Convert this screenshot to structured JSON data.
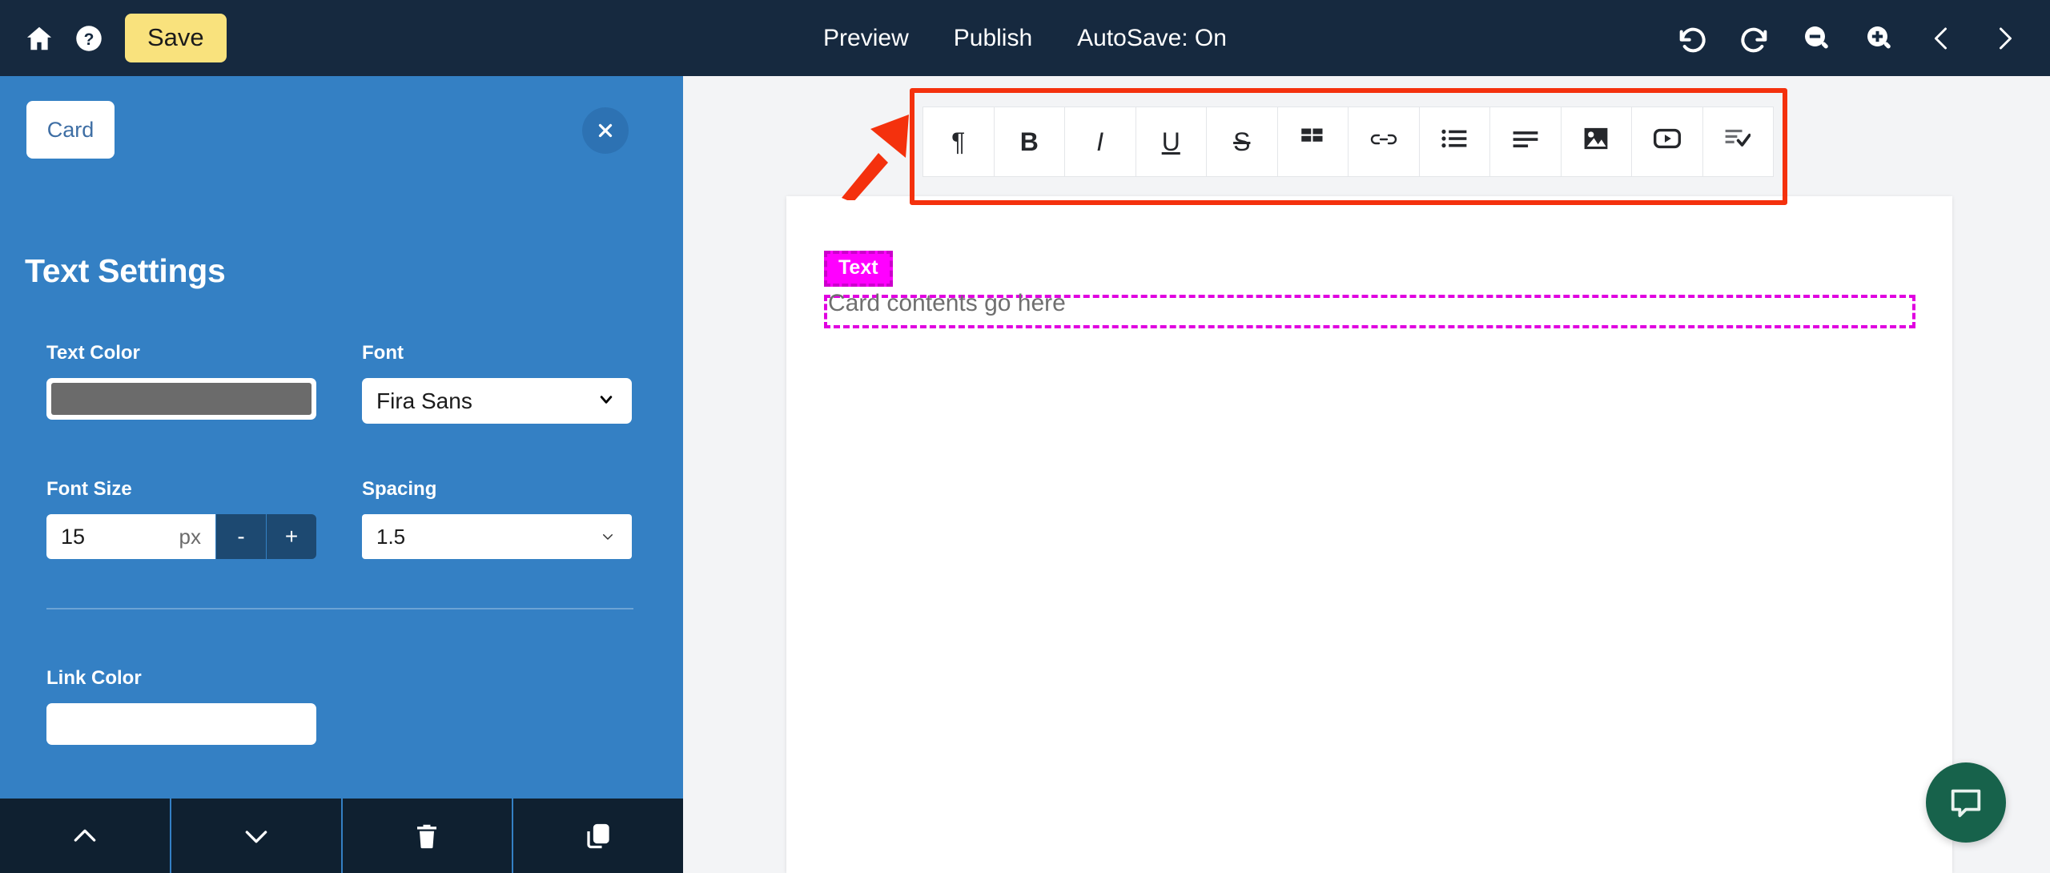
{
  "topbar": {
    "home_icon": "home-icon",
    "help_icon": "help-circle-icon",
    "save_label": "Save",
    "links": [
      {
        "label": "Preview",
        "name": "preview"
      },
      {
        "label": "Publish",
        "name": "publish"
      },
      {
        "label": "AutoSave: On",
        "name": "autosave"
      }
    ],
    "right_icons": [
      {
        "name": "undo-icon"
      },
      {
        "name": "redo-icon"
      },
      {
        "name": "zoom-out-icon"
      },
      {
        "name": "zoom-in-icon"
      },
      {
        "name": "chevron-left-icon"
      },
      {
        "name": "chevron-right-icon"
      }
    ]
  },
  "sidebar": {
    "tab_label": "Card",
    "close_icon": "close-icon",
    "title": "Text Settings",
    "fields": {
      "text_color": {
        "label": "Text Color",
        "value": "#6b6b6b"
      },
      "font": {
        "label": "Font",
        "value": "Fira Sans"
      },
      "font_size": {
        "label": "Font Size",
        "value": "15",
        "unit": "px",
        "decrement_label": "-",
        "increment_label": "+"
      },
      "spacing": {
        "label": "Spacing",
        "value": "1.5"
      },
      "link_color": {
        "label": "Link Color",
        "value": "#ffffff"
      }
    },
    "actions": [
      {
        "name": "move-up",
        "icon": "chevron-up-icon"
      },
      {
        "name": "move-down",
        "icon": "chevron-down-icon"
      },
      {
        "name": "delete",
        "icon": "trash-icon"
      },
      {
        "name": "duplicate",
        "icon": "copy-icon"
      }
    ]
  },
  "editor_toolbar": {
    "buttons": [
      {
        "name": "paragraph",
        "glyph": "¶"
      },
      {
        "name": "bold",
        "glyph": "B"
      },
      {
        "name": "italic",
        "glyph": "I"
      },
      {
        "name": "underline",
        "glyph": "U"
      },
      {
        "name": "strikethrough",
        "glyph": "S"
      },
      {
        "name": "table",
        "glyph": ""
      },
      {
        "name": "link",
        "glyph": ""
      },
      {
        "name": "bullet-list",
        "glyph": ""
      },
      {
        "name": "align-left",
        "glyph": ""
      },
      {
        "name": "image",
        "glyph": ""
      },
      {
        "name": "video",
        "glyph": ""
      },
      {
        "name": "spellcheck",
        "glyph": ""
      }
    ]
  },
  "canvas": {
    "badge_label": "Text",
    "placeholder_text": "Card contents go here"
  },
  "chat": {
    "icon": "chat-bubble-icon"
  },
  "colors": {
    "topbar_bg": "#16293f",
    "sidebar_bg": "#3480c4",
    "save_bg": "#f9e27d",
    "annotation_red": "#f4310d",
    "annotation_magenta": "#ff00ff",
    "chat_green": "#17624b",
    "stepper_btn": "#1d4971"
  }
}
